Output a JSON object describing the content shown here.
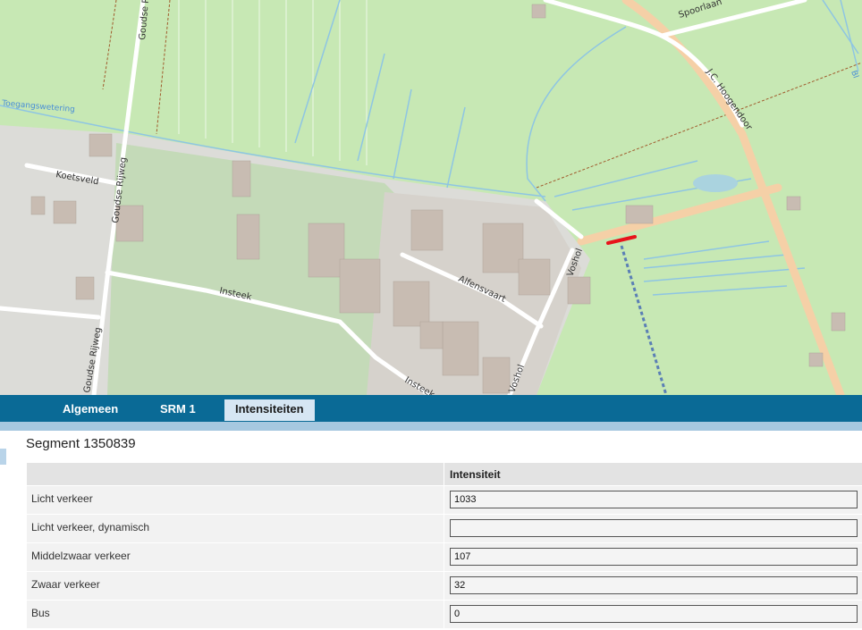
{
  "map": {
    "labels": {
      "goudse_rijp": "Goudse Rijp",
      "goudse_rijweg_top": "Goudse Rijweg",
      "goudse_rijweg_bottom": "Goudse Rijweg",
      "koetsveld": "Koetsveld",
      "toegangswetering": "Toegangswetering",
      "insteek_left": "Insteek",
      "insteek_right": "Insteek",
      "alfensvaart": "Alfensvaart",
      "vosholr": "Voshol",
      "vosholr_bottom": "Voshol",
      "spoorlaan": "Spoorlaan",
      "jc_hoogendoorn": "J.C. Hoogendoor",
      "bl": "Bl"
    },
    "colors": {
      "land": "#c7e8b4",
      "residential": "#e0dfdf",
      "building": "#c8bcb2",
      "road_main": "#f7d8b4",
      "road": "#ffffff",
      "water": "#aad3df",
      "selected_segment": "#e8131b"
    }
  },
  "tabs": [
    {
      "label": "Algemeen",
      "active": false
    },
    {
      "label": "SRM 1",
      "active": false
    },
    {
      "label": "Intensiteiten",
      "active": true
    }
  ],
  "segment": {
    "title": "Segment 1350839",
    "column_header": "Intensiteit",
    "rows": [
      {
        "label": "Licht verkeer",
        "value": "1033"
      },
      {
        "label": "Licht verkeer, dynamisch",
        "value": ""
      },
      {
        "label": "Middelzwaar verkeer",
        "value": "107"
      },
      {
        "label": "Zwaar verkeer",
        "value": "32"
      },
      {
        "label": "Bus",
        "value": "0"
      }
    ]
  }
}
